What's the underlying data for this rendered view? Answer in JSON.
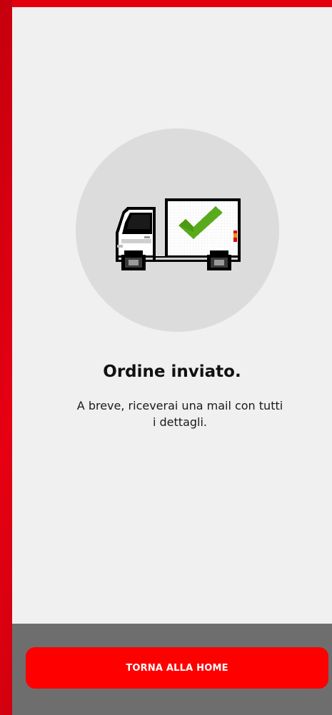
{
  "confirmation": {
    "title": "Ordine inviato.",
    "message": "A breve, riceverai una mail con tutti i dettagli.",
    "illustration_icon": "delivery-truck-checkmark-icon"
  },
  "footer": {
    "home_button_label": "TORNA ALLA HOME"
  },
  "colors": {
    "brand_red": "#e3000f",
    "button_red": "#ff0000",
    "background": "#f0f0f0",
    "footer_gray": "#6e6e6e",
    "check_green": "#5aaa1e"
  }
}
